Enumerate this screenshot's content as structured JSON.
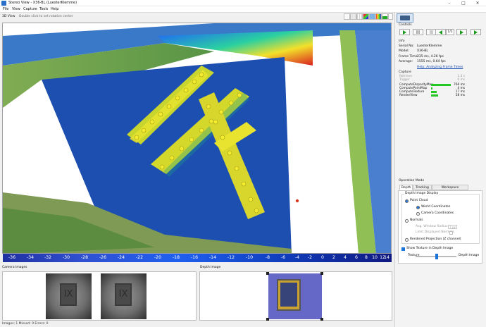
{
  "window": {
    "title": "Stereo View - X36-BL (LuesterKlemme)",
    "controls": [
      "–",
      "□",
      "✕"
    ]
  },
  "menu": [
    "File",
    "View",
    "Capture",
    "Tools",
    "Help"
  ],
  "view": {
    "tab_label": "3D View",
    "hint": "Double click to set rotation center",
    "toolbar_icons": [
      "camera-icon",
      "rotate-icon",
      "grid-icon",
      "axis-icon",
      "cube-icon",
      "palette-icon",
      "chart-icon",
      "pointer-icon"
    ]
  },
  "colorbar": {
    "ticks": [
      "-36",
      "-34",
      "-32",
      "-30",
      "-28",
      "-26",
      "-24",
      "-22",
      "-20",
      "-18",
      "-16",
      "-14",
      "-12",
      "-10",
      "-8",
      "-6",
      "-4",
      "-2",
      "0",
      "2",
      "4",
      "6",
      "8",
      "10",
      "12",
      "14",
      "16",
      "18"
    ]
  },
  "panels": {
    "camera_images": "Camera Images",
    "depth_image": "Depth Image"
  },
  "status": "Images:  1   Missed:  0   Errors:  0",
  "controls": {
    "header": "Controls",
    "frame": "1/1",
    "buttons": [
      "play-button",
      "pause-button",
      "stop-button",
      "prev-frame-button",
      "next-frame-button",
      "last-frame-button"
    ]
  },
  "info": {
    "header": "Info",
    "rows": [
      {
        "label": "Serial No:",
        "value": "LuesterKlemme"
      },
      {
        "label": "Model:",
        "value": "X36-BL"
      },
      {
        "label": "Frame Time:",
        "value": "235 ms, 4.26 fps"
      },
      {
        "label": "Average:",
        "value": "1555 ms, 0.64 fps"
      }
    ],
    "link": "Help: Analyzing Frame Times"
  },
  "capture": {
    "header": "Capture",
    "rows": [
      {
        "label": "Retrieve",
        "value": "1.3 s",
        "bar": 0,
        "muted": true
      },
      {
        "label": "Trigger",
        "value": "0 ms",
        "bar": 0,
        "muted": true
      },
      {
        "label": "ComputeDisparityMap",
        "value": "766 ms",
        "bar": 1.0,
        "muted": false
      },
      {
        "label": "ComputePointMap",
        "value": "4 ms",
        "bar": 0.08,
        "muted": false
      },
      {
        "label": "ComputeTexture",
        "value": "17 ms",
        "bar": 0.3,
        "muted": false
      },
      {
        "label": "RenderView",
        "value": "58 ms",
        "bar": 0.35,
        "muted": false
      }
    ]
  },
  "operation": {
    "header": "Operation Mode",
    "tabs": [
      "Depth",
      "Tracking",
      "Workspace Calibration"
    ],
    "group_title": "Depth Image Display",
    "point_cloud": "Point Cloud",
    "world_coords": "World Coordinates",
    "camera_coords": "Camera Coordinates",
    "normals": "Normals",
    "avg_radius_label": "Avg. Window Radius",
    "avg_radius_value": "7 px",
    "limit_normals": "Limit Displayed Normals",
    "rendered_projection": "Rendered Projection (Z channel)",
    "show_texture": "Show Texture in Depth Image",
    "texture_label": "Texture",
    "depth_label": "Depth Image",
    "blend": 0.5
  }
}
